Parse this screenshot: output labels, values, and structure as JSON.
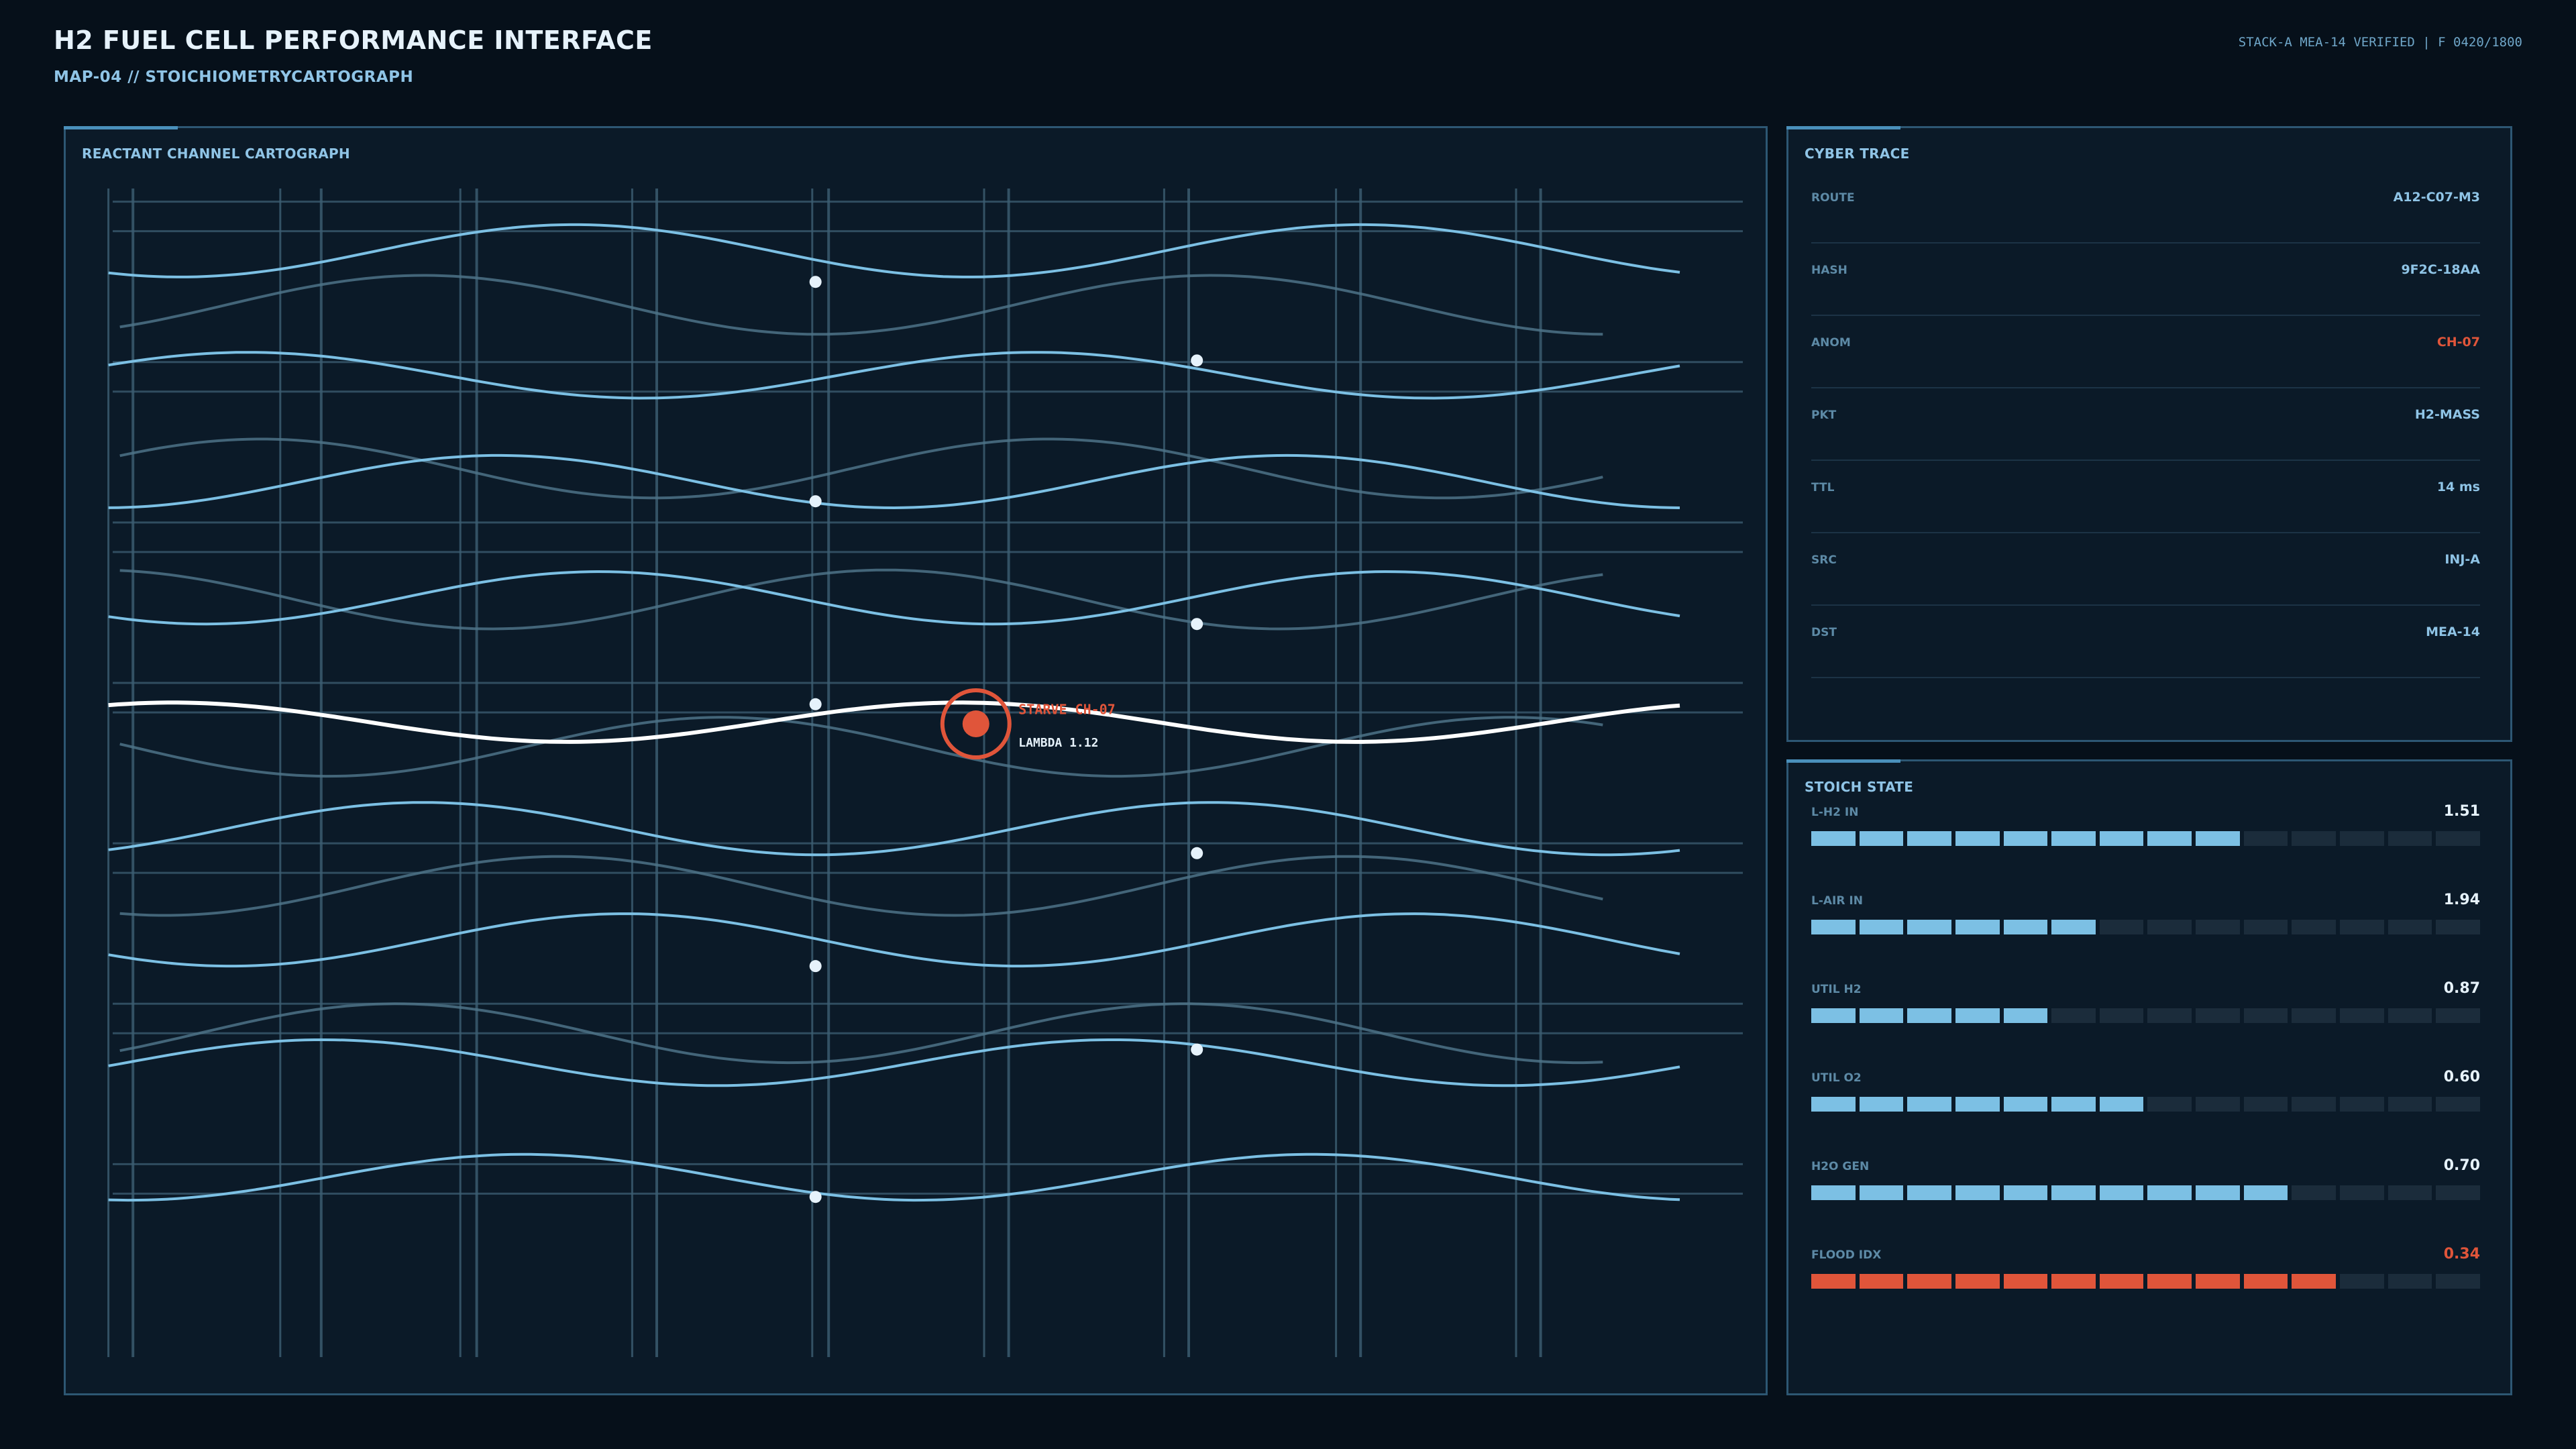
{
  "header": {
    "title": "H2 FUEL CELL PERFORMANCE INTERFACE",
    "subtitle": "MAP-04 // STOICHIOMETRYCARTOGRAPH",
    "verification": "STACK-A MEA-14 VERIFIED | F 0420/1800"
  },
  "cartograph": {
    "title": "REACTANT CHANNEL CARTOGRAPH",
    "marker_label": "STARVE CH-07",
    "marker_sub": "LAMBDA 1.12"
  },
  "cyber_trace": {
    "title": "CYBER TRACE",
    "rows": [
      {
        "key": "ROUTE",
        "value": "A12-C07-M3",
        "alert": false
      },
      {
        "key": "HASH",
        "value": "9F2C-18AA",
        "alert": false
      },
      {
        "key": "ANOM",
        "value": "CH-07",
        "alert": true
      },
      {
        "key": "PKT",
        "value": "H2-MASS",
        "alert": false
      },
      {
        "key": "TTL",
        "value": "14 ms",
        "alert": false
      },
      {
        "key": "SRC",
        "value": "INJ-A",
        "alert": false
      },
      {
        "key": "DST",
        "value": "MEA-14",
        "alert": false
      }
    ]
  },
  "stoich_state": {
    "title": "STOICH STATE",
    "meters": [
      {
        "label": "L-H2 IN",
        "value": "1.51",
        "filled": 9,
        "alert": false
      },
      {
        "label": "L-AIR IN",
        "value": "1.94",
        "filled": 6,
        "alert": false
      },
      {
        "label": "UTIL H2",
        "value": "0.87",
        "filled": 5,
        "alert": false
      },
      {
        "label": "UTIL O2",
        "value": "0.60",
        "filled": 7,
        "alert": false
      },
      {
        "label": "H2O GEN",
        "value": "0.70",
        "filled": 10,
        "alert": false
      },
      {
        "label": "FLOOD IDX",
        "value": "0.34",
        "filled": 11,
        "alert": true
      }
    ],
    "segments_total": 14
  },
  "colors": {
    "accent": "#7cc0e4",
    "alert": "#e0553a",
    "highlight": "#ffffff"
  }
}
